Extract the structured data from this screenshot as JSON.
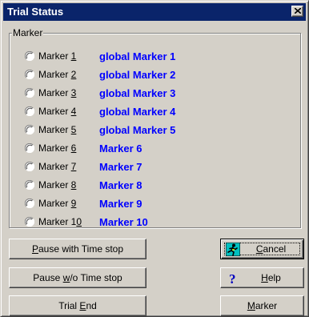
{
  "window": {
    "title": "Trial Status"
  },
  "group": {
    "legend": "Marker"
  },
  "markers": [
    {
      "pre": "Marker ",
      "key": "1",
      "post": "",
      "name": "global  Marker 1"
    },
    {
      "pre": "Marker ",
      "key": "2",
      "post": "",
      "name": "global  Marker 2"
    },
    {
      "pre": "Marker ",
      "key": "3",
      "post": "",
      "name": "global  Marker 3"
    },
    {
      "pre": "Marker ",
      "key": "4",
      "post": "",
      "name": "global  Marker 4"
    },
    {
      "pre": "Marker ",
      "key": "5",
      "post": "",
      "name": "global  Marker 5"
    },
    {
      "pre": "Marker ",
      "key": "6",
      "post": "",
      "name": "Marker 6"
    },
    {
      "pre": "Marker ",
      "key": "7",
      "post": "",
      "name": "Marker 7"
    },
    {
      "pre": "Marker ",
      "key": "8",
      "post": "",
      "name": "Marker 8"
    },
    {
      "pre": "Marker ",
      "key": "9",
      "post": "",
      "name": "Marker 9"
    },
    {
      "pre": "Marker 1",
      "key": "0",
      "post": "",
      "name": "Marker 10"
    }
  ],
  "buttons": {
    "pause_time_stop": {
      "pre": "",
      "key": "P",
      "post": "ause with Time stop"
    },
    "pause_wo_time_stop": {
      "pre": "Pause ",
      "key": "w",
      "post": "/o Time stop"
    },
    "trial_end": {
      "pre": "Trial ",
      "key": "E",
      "post": "nd"
    },
    "cancel": {
      "pre": "",
      "key": "C",
      "post": "ancel",
      "icon": "running-man-icon"
    },
    "help": {
      "pre": "",
      "key": "H",
      "post": "elp",
      "icon": "question-mark-icon"
    },
    "marker": {
      "pre": "",
      "key": "M",
      "post": "arker"
    }
  },
  "colors": {
    "titlebar": "#0a246a",
    "marker_name": "#0000ff",
    "face": "#d4d0c8"
  }
}
